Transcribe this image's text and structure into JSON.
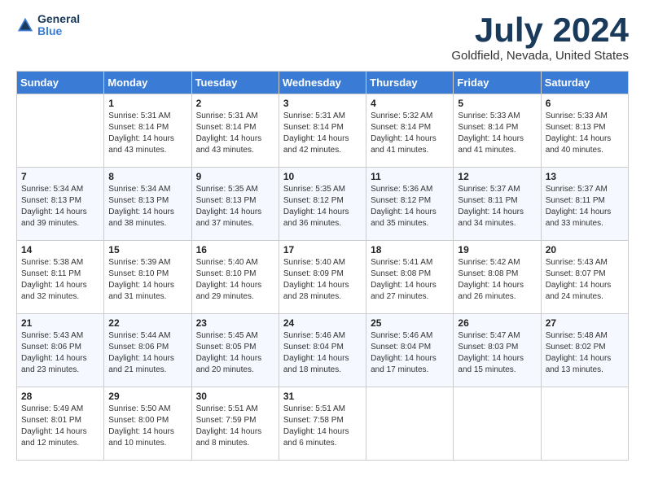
{
  "header": {
    "logo_general": "General",
    "logo_blue": "Blue",
    "month_title": "July 2024",
    "location": "Goldfield, Nevada, United States"
  },
  "calendar": {
    "weekdays": [
      "Sunday",
      "Monday",
      "Tuesday",
      "Wednesday",
      "Thursday",
      "Friday",
      "Saturday"
    ],
    "weeks": [
      [
        {
          "day": "",
          "sunrise": "",
          "sunset": "",
          "daylight": ""
        },
        {
          "day": "1",
          "sunrise": "Sunrise: 5:31 AM",
          "sunset": "Sunset: 8:14 PM",
          "daylight": "Daylight: 14 hours and 43 minutes."
        },
        {
          "day": "2",
          "sunrise": "Sunrise: 5:31 AM",
          "sunset": "Sunset: 8:14 PM",
          "daylight": "Daylight: 14 hours and 43 minutes."
        },
        {
          "day": "3",
          "sunrise": "Sunrise: 5:31 AM",
          "sunset": "Sunset: 8:14 PM",
          "daylight": "Daylight: 14 hours and 42 minutes."
        },
        {
          "day": "4",
          "sunrise": "Sunrise: 5:32 AM",
          "sunset": "Sunset: 8:14 PM",
          "daylight": "Daylight: 14 hours and 41 minutes."
        },
        {
          "day": "5",
          "sunrise": "Sunrise: 5:33 AM",
          "sunset": "Sunset: 8:14 PM",
          "daylight": "Daylight: 14 hours and 41 minutes."
        },
        {
          "day": "6",
          "sunrise": "Sunrise: 5:33 AM",
          "sunset": "Sunset: 8:13 PM",
          "daylight": "Daylight: 14 hours and 40 minutes."
        }
      ],
      [
        {
          "day": "7",
          "sunrise": "Sunrise: 5:34 AM",
          "sunset": "Sunset: 8:13 PM",
          "daylight": "Daylight: 14 hours and 39 minutes."
        },
        {
          "day": "8",
          "sunrise": "Sunrise: 5:34 AM",
          "sunset": "Sunset: 8:13 PM",
          "daylight": "Daylight: 14 hours and 38 minutes."
        },
        {
          "day": "9",
          "sunrise": "Sunrise: 5:35 AM",
          "sunset": "Sunset: 8:13 PM",
          "daylight": "Daylight: 14 hours and 37 minutes."
        },
        {
          "day": "10",
          "sunrise": "Sunrise: 5:35 AM",
          "sunset": "Sunset: 8:12 PM",
          "daylight": "Daylight: 14 hours and 36 minutes."
        },
        {
          "day": "11",
          "sunrise": "Sunrise: 5:36 AM",
          "sunset": "Sunset: 8:12 PM",
          "daylight": "Daylight: 14 hours and 35 minutes."
        },
        {
          "day": "12",
          "sunrise": "Sunrise: 5:37 AM",
          "sunset": "Sunset: 8:11 PM",
          "daylight": "Daylight: 14 hours and 34 minutes."
        },
        {
          "day": "13",
          "sunrise": "Sunrise: 5:37 AM",
          "sunset": "Sunset: 8:11 PM",
          "daylight": "Daylight: 14 hours and 33 minutes."
        }
      ],
      [
        {
          "day": "14",
          "sunrise": "Sunrise: 5:38 AM",
          "sunset": "Sunset: 8:11 PM",
          "daylight": "Daylight: 14 hours and 32 minutes."
        },
        {
          "day": "15",
          "sunrise": "Sunrise: 5:39 AM",
          "sunset": "Sunset: 8:10 PM",
          "daylight": "Daylight: 14 hours and 31 minutes."
        },
        {
          "day": "16",
          "sunrise": "Sunrise: 5:40 AM",
          "sunset": "Sunset: 8:10 PM",
          "daylight": "Daylight: 14 hours and 29 minutes."
        },
        {
          "day": "17",
          "sunrise": "Sunrise: 5:40 AM",
          "sunset": "Sunset: 8:09 PM",
          "daylight": "Daylight: 14 hours and 28 minutes."
        },
        {
          "day": "18",
          "sunrise": "Sunrise: 5:41 AM",
          "sunset": "Sunset: 8:08 PM",
          "daylight": "Daylight: 14 hours and 27 minutes."
        },
        {
          "day": "19",
          "sunrise": "Sunrise: 5:42 AM",
          "sunset": "Sunset: 8:08 PM",
          "daylight": "Daylight: 14 hours and 26 minutes."
        },
        {
          "day": "20",
          "sunrise": "Sunrise: 5:43 AM",
          "sunset": "Sunset: 8:07 PM",
          "daylight": "Daylight: 14 hours and 24 minutes."
        }
      ],
      [
        {
          "day": "21",
          "sunrise": "Sunrise: 5:43 AM",
          "sunset": "Sunset: 8:06 PM",
          "daylight": "Daylight: 14 hours and 23 minutes."
        },
        {
          "day": "22",
          "sunrise": "Sunrise: 5:44 AM",
          "sunset": "Sunset: 8:06 PM",
          "daylight": "Daylight: 14 hours and 21 minutes."
        },
        {
          "day": "23",
          "sunrise": "Sunrise: 5:45 AM",
          "sunset": "Sunset: 8:05 PM",
          "daylight": "Daylight: 14 hours and 20 minutes."
        },
        {
          "day": "24",
          "sunrise": "Sunrise: 5:46 AM",
          "sunset": "Sunset: 8:04 PM",
          "daylight": "Daylight: 14 hours and 18 minutes."
        },
        {
          "day": "25",
          "sunrise": "Sunrise: 5:46 AM",
          "sunset": "Sunset: 8:04 PM",
          "daylight": "Daylight: 14 hours and 17 minutes."
        },
        {
          "day": "26",
          "sunrise": "Sunrise: 5:47 AM",
          "sunset": "Sunset: 8:03 PM",
          "daylight": "Daylight: 14 hours and 15 minutes."
        },
        {
          "day": "27",
          "sunrise": "Sunrise: 5:48 AM",
          "sunset": "Sunset: 8:02 PM",
          "daylight": "Daylight: 14 hours and 13 minutes."
        }
      ],
      [
        {
          "day": "28",
          "sunrise": "Sunrise: 5:49 AM",
          "sunset": "Sunset: 8:01 PM",
          "daylight": "Daylight: 14 hours and 12 minutes."
        },
        {
          "day": "29",
          "sunrise": "Sunrise: 5:50 AM",
          "sunset": "Sunset: 8:00 PM",
          "daylight": "Daylight: 14 hours and 10 minutes."
        },
        {
          "day": "30",
          "sunrise": "Sunrise: 5:51 AM",
          "sunset": "Sunset: 7:59 PM",
          "daylight": "Daylight: 14 hours and 8 minutes."
        },
        {
          "day": "31",
          "sunrise": "Sunrise: 5:51 AM",
          "sunset": "Sunset: 7:58 PM",
          "daylight": "Daylight: 14 hours and 6 minutes."
        },
        {
          "day": "",
          "sunrise": "",
          "sunset": "",
          "daylight": ""
        },
        {
          "day": "",
          "sunrise": "",
          "sunset": "",
          "daylight": ""
        },
        {
          "day": "",
          "sunrise": "",
          "sunset": "",
          "daylight": ""
        }
      ]
    ]
  }
}
